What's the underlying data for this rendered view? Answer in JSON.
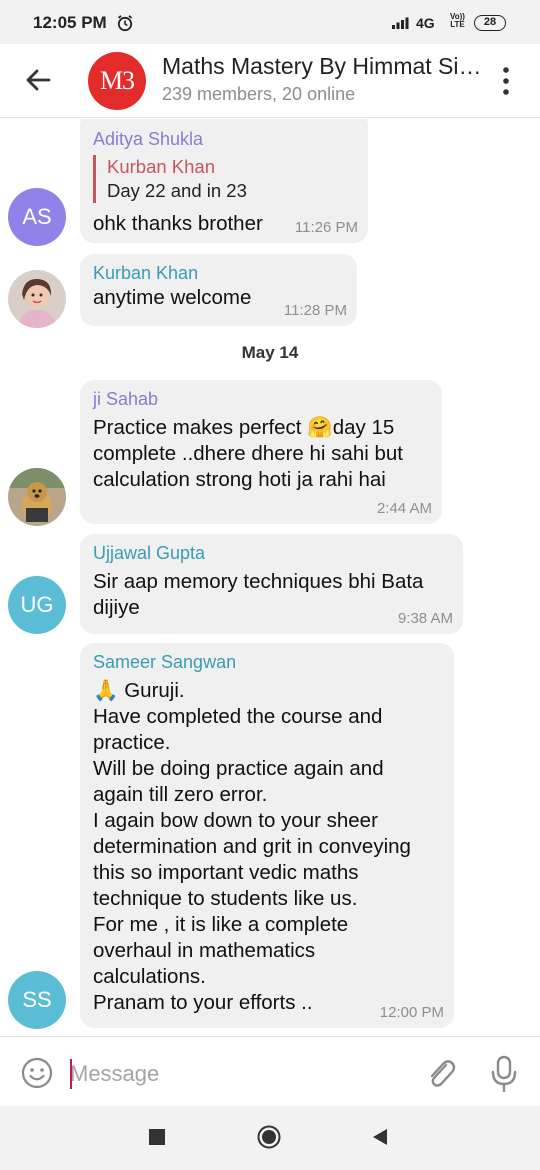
{
  "status_bar": {
    "time": "12:05 PM",
    "network": "4G",
    "volte_top": "Vo))",
    "volte_bottom": "LTE",
    "battery": "28"
  },
  "header": {
    "avatar_text": "M3",
    "title": "Maths Mastery By Himmat Singh",
    "subtitle": "239 members, 20 online"
  },
  "messages": [
    {
      "sender": "Aditya Shukla",
      "sender_color": "#8c7ad1",
      "reply_name": "Kurban Khan",
      "reply_text": "Day 22 and in 23",
      "text": "ohk thanks brother",
      "time": "11:26 PM",
      "avatar_initials": "AS",
      "avatar_color": "#8f82e8"
    },
    {
      "sender": "Kurban Khan",
      "sender_color": "#3a9bb5",
      "text": "anytime welcome",
      "time": "11:28 PM",
      "avatar": "photo-girl-icon"
    },
    {
      "date": "May 14"
    },
    {
      "sender": "ji Sahab",
      "sender_color": "#8c7ad1",
      "text": "Practice makes perfect 🤗day 15\ncomplete ..dhere dhere hi sahi but\ncalculation strong hoti ja rahi hai",
      "time": "2:44 AM",
      "avatar": "photo-dog-icon"
    },
    {
      "sender": "Ujjawal Gupta",
      "sender_color": "#3a9bb5",
      "text": "Sir aap memory techniques bhi Bata\ndijiye",
      "time": "9:38 AM",
      "avatar_initials": "UG",
      "avatar_color": "#5bbcd6"
    },
    {
      "sender": "Sameer Sangwan",
      "sender_color": "#3a9bb5",
      "text": "🙏 Guruji.\nHave completed the course and\npractice.\nWill be doing practice again and\nagain till zero error.\nI again bow down to your sheer\ndetermination and grit in conveying\nthis so important vedic maths\ntechnique to students like us.\nFor me , it is like a complete\noverhaul in mathematics\ncalculations.\nPranam to your efforts ..",
      "time": "12:00 PM",
      "avatar_initials": "SS",
      "avatar_color": "#5bbcd6"
    }
  ],
  "composer": {
    "placeholder": "Message"
  },
  "icons": {
    "back": "arrow-left-icon",
    "menu": "more-vert-icon",
    "emoji": "emoji-icon",
    "attach": "paperclip-icon",
    "mic": "microphone-icon",
    "alarm": "alarm-clock-icon",
    "signal": "signal-bars-icon"
  }
}
